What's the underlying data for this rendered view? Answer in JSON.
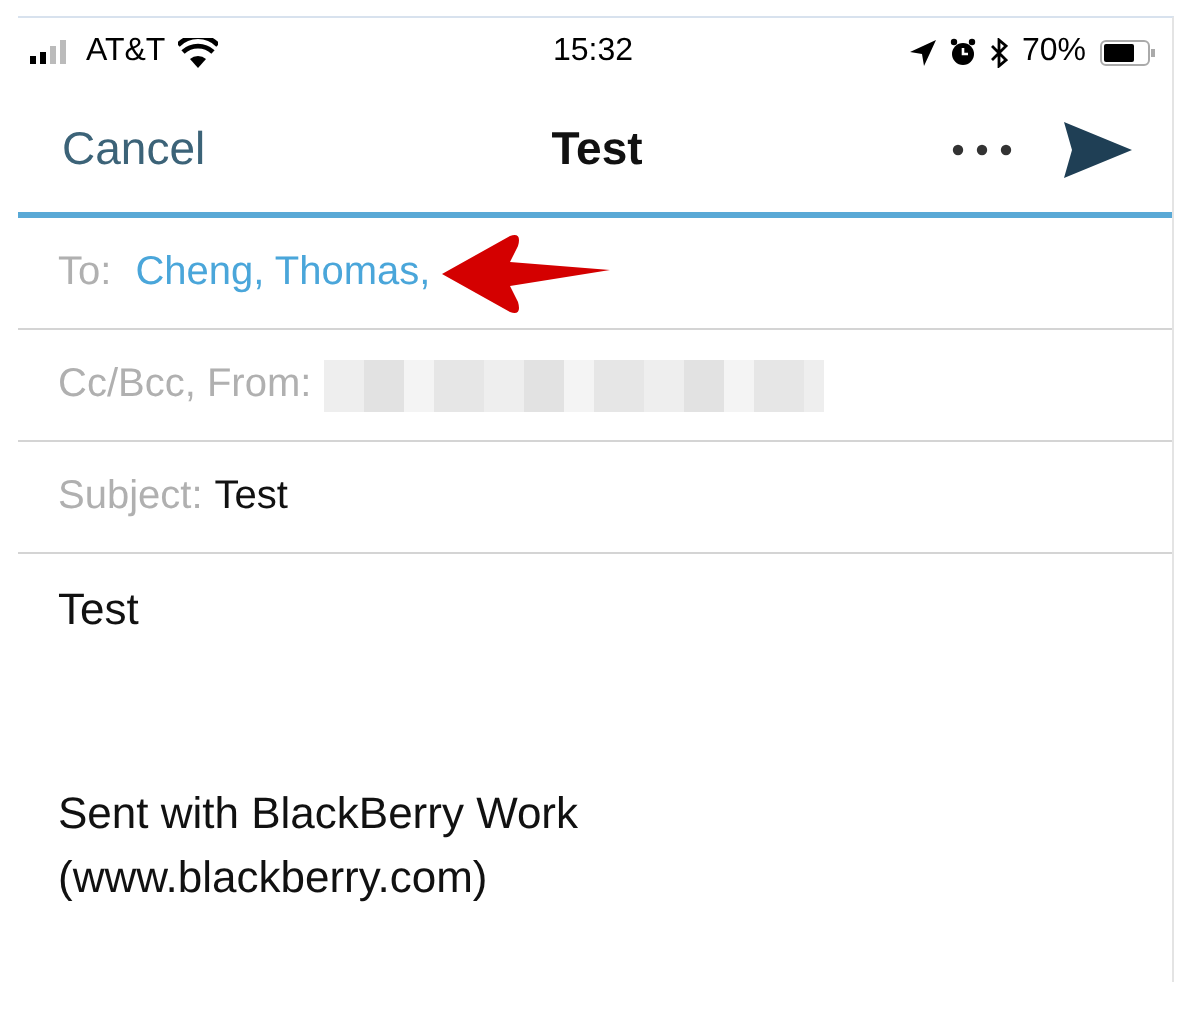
{
  "status_bar": {
    "carrier": "AT&T",
    "time": "15:32",
    "battery": "70%"
  },
  "nav": {
    "cancel": "Cancel",
    "title": "Test"
  },
  "fields": [
    {
      "kind": "recipients",
      "label": "To:",
      "value": "Cheng, Thomas,"
    },
    {
      "kind": "redacted",
      "label": "Cc/Bcc, From:"
    },
    {
      "kind": "text",
      "label": "Subject:",
      "value": "Test"
    }
  ],
  "body": {
    "text": "Test",
    "signature": [
      "Sent with BlackBerry Work",
      "(www.blackberry.com)"
    ]
  }
}
